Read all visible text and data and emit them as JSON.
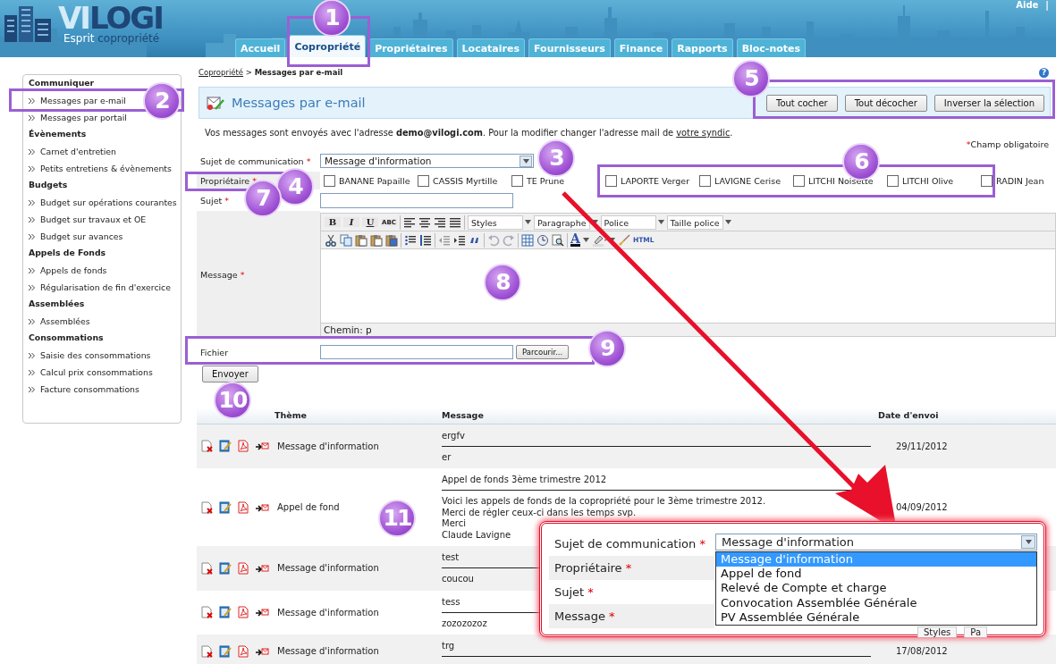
{
  "header": {
    "logo": {
      "parts": [
        "VI",
        "LOGI"
      ]
    },
    "tagline": {
      "parts": [
        "Esprit",
        "copropriété"
      ]
    },
    "help_link": "Aide",
    "separator": "|",
    "tabs": [
      {
        "label": "Accueil",
        "selected": false
      },
      {
        "label": "Copropriété",
        "selected": true
      },
      {
        "label": "Propriétaires",
        "selected": false
      },
      {
        "label": "Locataires",
        "selected": false
      },
      {
        "label": "Fournisseurs",
        "selected": false
      },
      {
        "label": "Finance",
        "selected": false
      },
      {
        "label": "Rapports",
        "selected": false
      },
      {
        "label": "Bloc-notes",
        "selected": false
      }
    ]
  },
  "sidebar": {
    "sections": [
      {
        "heading": "Communiquer",
        "items": [
          "Messages par e-mail",
          "Messages par portail"
        ]
      },
      {
        "heading": "Évènements",
        "items": [
          "Carnet d'entretien",
          "Petits entretiens & évènements"
        ]
      },
      {
        "heading": "Budgets",
        "items": [
          "Budget sur opérations courantes",
          "Budget sur travaux et OE",
          "Budget sur avances"
        ]
      },
      {
        "heading": "Appels de Fonds",
        "items": [
          "Appels de fonds",
          "Régularisation de fin d'exercice"
        ]
      },
      {
        "heading": "Assemblées",
        "items": [
          "Assemblées"
        ]
      },
      {
        "heading": "Consommations",
        "items": [
          "Saisie des consommations",
          "Calcul prix consommations",
          "Facture consommations"
        ]
      }
    ]
  },
  "breadcrumb": {
    "link": "Copropriété",
    "separator": ">",
    "current": "Messages par e-mail",
    "help_icon": "?"
  },
  "panel": {
    "title": "Messages par e-mail",
    "buttons": [
      "Tout cocher",
      "Tout décocher",
      "Inverser la sélection"
    ]
  },
  "notice": {
    "text": "Vos messages sont envoyés avec l'adresse **demo@vilogi.com**. Pour la modifier changer l'adresse mail de ",
    "link": "votre syndic",
    "end": "."
  },
  "required_note": {
    "mark": "*",
    "text": "Champ obligatoire"
  },
  "form": {
    "fields": [
      {
        "kind": "select",
        "label": "Sujet de communication",
        "required_mark": "*",
        "value": "Message d'information"
      },
      {
        "kind": "checkboxes",
        "label": "Propriétaire",
        "required_mark": "*",
        "options": [
          {
            "label": "BANANE Papaille",
            "checked": false
          },
          {
            "label": "CASSIS Myrtille",
            "checked": false
          },
          {
            "label": "TE Prune",
            "checked": false
          },
          {
            "label": "LAPORTE Verger",
            "checked": false
          },
          {
            "label": "LAVIGNE Cerise",
            "checked": false
          },
          {
            "label": "LITCHI Noisette",
            "checked": false
          },
          {
            "label": "LITCHI Olive",
            "checked": false
          },
          {
            "label": "RADIN Jean",
            "checked": false
          }
        ]
      },
      {
        "kind": "text",
        "label": "Sujet",
        "required_mark": "*"
      },
      {
        "kind": "editor",
        "label": "Message",
        "required_mark": "*",
        "format_buttons": [
          "B",
          "I",
          "U",
          "ABC"
        ],
        "selects": [
          "Styles",
          "Paragraphe",
          "Police",
          "Taille police"
        ],
        "color_button": "A",
        "html_button": "HTML",
        "path": "Chemin: p"
      },
      {
        "kind": "file",
        "label": "Fichier",
        "browse_button": "Parcourir..."
      }
    ],
    "submit": "Envoyer"
  },
  "table": {
    "columns": [
      "Thème",
      "Message",
      "Date d'envoi"
    ],
    "rows": [
      {
        "theme": "Message d'information",
        "subject": "ergfv",
        "body": [
          "er"
        ],
        "date": "29/11/2012"
      },
      {
        "theme": "Appel de fond",
        "subject": "Appel de fonds 3ème trimestre 2012",
        "body": [
          "Voici les appels de fonds de la copropriété pour le 3ème trimestre 2012.",
          "Merci de régler ceux-ci dans les temps svp.",
          "Merci",
          "Claude Lavigne"
        ],
        "date": "04/09/2012"
      },
      {
        "theme": "Message d'information",
        "subject": "test",
        "body": [
          "coucou"
        ]
      },
      {
        "theme": "Message d'information",
        "subject": "tess",
        "body": [
          "zozozozoz"
        ]
      },
      {
        "theme": "Message d'information",
        "subject": "trg",
        "date": "17/08/2012"
      }
    ]
  },
  "callouts": [
    "1",
    "2",
    "3",
    "4",
    "5",
    "6",
    "7",
    "8",
    "9",
    "10",
    "11"
  ],
  "inset": {
    "fields": [
      {
        "label": "Sujet de communication",
        "mark": "*",
        "value": "Message d'information"
      },
      {
        "label": "Propriétaire",
        "mark": "*"
      },
      {
        "label": "Sujet",
        "mark": "*"
      },
      {
        "label": "Message",
        "mark": "*"
      }
    ],
    "options": [
      {
        "label": "Message d'information",
        "selected": true
      },
      {
        "label": "Appel de fond",
        "selected": false
      },
      {
        "label": "Relevé de Compte et charge",
        "selected": false
      },
      {
        "label": "Convocation Assemblée Générale",
        "selected": false
      },
      {
        "label": "PV Assemblée Générale",
        "selected": false
      }
    ],
    "selects": [
      "Styles",
      "Pa"
    ]
  }
}
